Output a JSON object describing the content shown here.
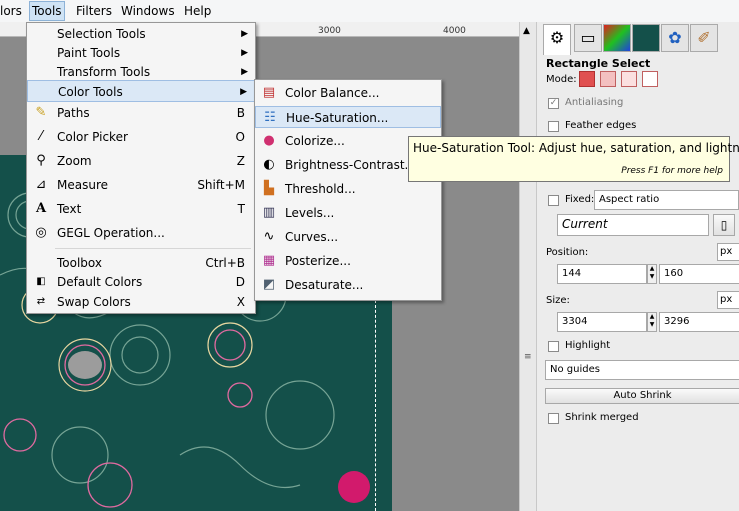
{
  "menubar": {
    "items": [
      "lors",
      "Tools",
      "Filters",
      "Windows",
      "Help"
    ],
    "active_index": 1
  },
  "ruler": {
    "ticks": [
      "3000",
      "4000"
    ]
  },
  "tools_menu": {
    "items": [
      {
        "label": "Selection Tools",
        "submenu": true,
        "icon": ""
      },
      {
        "label": "Paint Tools",
        "submenu": true,
        "icon": ""
      },
      {
        "label": "Transform Tools",
        "submenu": true,
        "icon": ""
      },
      {
        "label": "Color Tools",
        "submenu": true,
        "icon": "",
        "highlighted": true
      },
      {
        "label": "Paths",
        "shortcut": "B",
        "icon": "paths-icon"
      },
      {
        "label": "Color Picker",
        "shortcut": "O",
        "icon": "color-picker-icon"
      },
      {
        "label": "Zoom",
        "shortcut": "Z",
        "icon": "zoom-icon"
      },
      {
        "label": "Measure",
        "shortcut": "Shift+M",
        "icon": "measure-icon"
      },
      {
        "label": "Text",
        "shortcut": "T",
        "icon": "text-icon"
      },
      {
        "label": "GEGL Operation...",
        "shortcut": "",
        "icon": "gegl-icon"
      },
      {
        "label": "Toolbox",
        "shortcut": "Ctrl+B",
        "icon": ""
      },
      {
        "label": "Default Colors",
        "shortcut": "D",
        "icon": "default-colors-icon"
      },
      {
        "label": "Swap Colors",
        "shortcut": "X",
        "icon": "swap-colors-icon"
      }
    ]
  },
  "color_menu": {
    "items": [
      {
        "label": "Color Balance...",
        "icon": "color-balance-icon"
      },
      {
        "label": "Hue-Saturation...",
        "icon": "hue-saturation-icon",
        "highlighted": true
      },
      {
        "label": "Colorize...",
        "icon": "colorize-icon"
      },
      {
        "label": "Brightness-Contrast...",
        "icon": "brightness-contrast-icon"
      },
      {
        "label": "Threshold...",
        "icon": "threshold-icon"
      },
      {
        "label": "Levels...",
        "icon": "levels-icon"
      },
      {
        "label": "Curves...",
        "icon": "curves-icon"
      },
      {
        "label": "Posterize...",
        "icon": "posterize-icon"
      },
      {
        "label": "Desaturate...",
        "icon": "desaturate-icon"
      }
    ]
  },
  "tooltip": {
    "text": "Hue-Saturation Tool: Adjust hue, saturation, and lightness",
    "hint": "Press F1 for more help"
  },
  "panel": {
    "title": "Rectangle Select",
    "mode_label": "Mode:",
    "antialiasing": "Antialiasing",
    "antialiasing_checked": true,
    "feather": "Feather edges",
    "fixed_label": "Fixed:",
    "fixed_value": "Aspect ratio",
    "current_value": "Current",
    "position_label": "Position:",
    "position_unit": "px",
    "pos_x": "144",
    "pos_y": "160",
    "size_label": "Size:",
    "size_unit": "px",
    "size_w": "3304",
    "size_h": "3296",
    "highlight": "Highlight",
    "guides_value": "No guides",
    "auto_shrink": "Auto Shrink",
    "shrink_merged": "Shrink merged"
  },
  "colors": {
    "image_bg": "#14504a",
    "accent_pink": "#d21a6c",
    "menu_highlight": "#dbe8f6"
  }
}
